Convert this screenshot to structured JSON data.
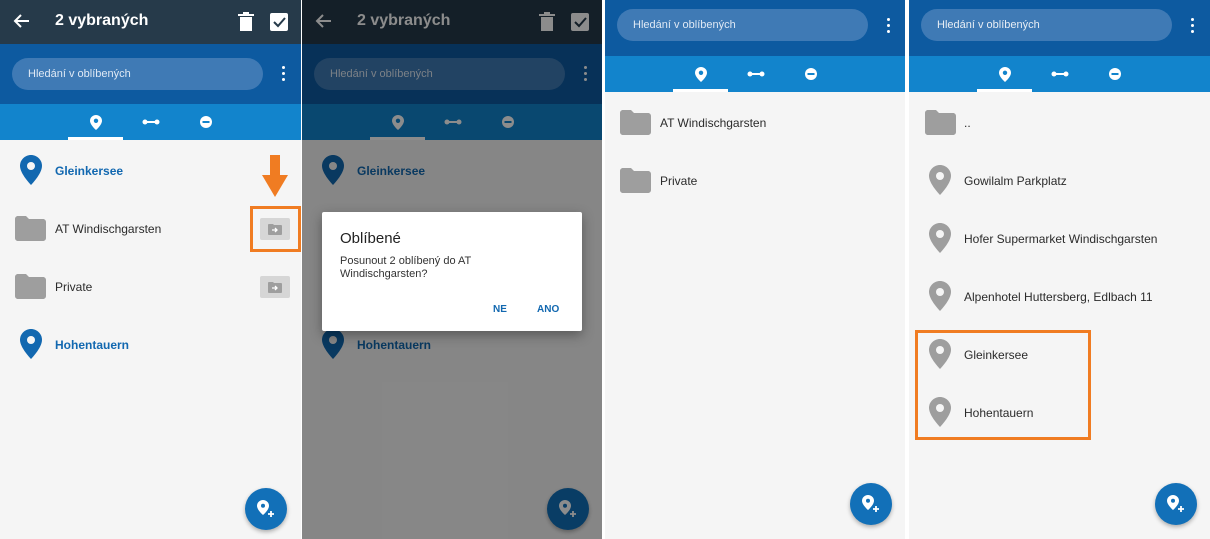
{
  "colors": {
    "topbar": "#263a4a",
    "primary_dark": "#0d5aa0",
    "tab_blue": "#1284cc",
    "accent_blue": "#1268b0",
    "highlight_orange": "#f07c22",
    "folder_gray": "#9e9e9e"
  },
  "screen1": {
    "action_bar": {
      "title": "2 vybraných"
    },
    "search": {
      "placeholder": "Hledání v oblíbených"
    },
    "tabs": [
      {
        "icon": "pin-icon"
      },
      {
        "icon": "route-icon"
      },
      {
        "icon": "rec-icon"
      }
    ],
    "items": [
      {
        "label": "Gleinkersee",
        "type": "favorite-selected"
      },
      {
        "label": "AT Windischgarsten",
        "type": "folder"
      },
      {
        "label": "Private",
        "type": "folder"
      },
      {
        "label": "Hohentauern",
        "type": "favorite-selected"
      }
    ]
  },
  "screen2": {
    "action_bar": {
      "title": "2 vybraných"
    },
    "search": {
      "placeholder": "Hledání v oblíbených"
    },
    "items": [
      {
        "label": "Gleinkersee"
      },
      {
        "label": "Hohentauern"
      }
    ],
    "dialog": {
      "title": "Oblíbené",
      "message": "Posunout 2 oblíbený do AT Windischgarsten?",
      "cancel": "NE",
      "confirm": "ANO"
    }
  },
  "screen3": {
    "search": {
      "placeholder": "Hledání v oblíbených"
    },
    "items": [
      {
        "label": "AT Windischgarsten",
        "type": "folder"
      },
      {
        "label": "Private",
        "type": "folder"
      }
    ]
  },
  "screen4": {
    "search": {
      "placeholder": "Hledání v oblíbených"
    },
    "items": [
      {
        "label": "..",
        "type": "folder-up"
      },
      {
        "label": "Gowilalm Parkplatz",
        "type": "favorite"
      },
      {
        "label": "Hofer Supermarket Windischgarsten",
        "type": "favorite"
      },
      {
        "label": "Alpenhotel Huttersberg, Edlbach 11",
        "type": "favorite"
      },
      {
        "label": "Gleinkersee",
        "type": "favorite"
      },
      {
        "label": "Hohentauern",
        "type": "favorite"
      }
    ]
  }
}
